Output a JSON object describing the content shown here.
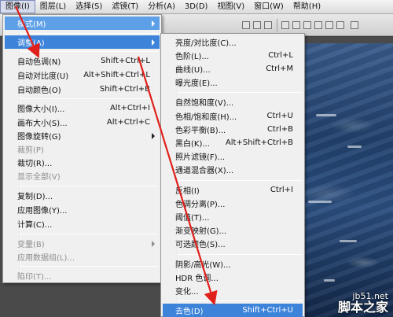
{
  "menubar": [
    "图像(I)",
    "图层(L)",
    "选择(S)",
    "滤镜(T)",
    "分析(A)",
    "3D(D)",
    "视图(V)",
    "窗口(W)",
    "帮助(H)"
  ],
  "image_menu": {
    "mode": "模式(M)",
    "adjust": "调整(A)",
    "auto_tone": {
      "label": "自动色调(N)",
      "shortcut": "Shift+Ctrl+L"
    },
    "auto_contrast": {
      "label": "自动对比度(U)",
      "shortcut": "Alt+Shift+Ctrl+L"
    },
    "auto_color": {
      "label": "自动颜色(O)",
      "shortcut": "Shift+Ctrl+B"
    },
    "image_size": {
      "label": "图像大小(I)...",
      "shortcut": "Alt+Ctrl+I"
    },
    "canvas_size": {
      "label": "画布大小(S)...",
      "shortcut": "Alt+Ctrl+C"
    },
    "rotate": "图像旋转(G)",
    "crop": "裁剪(P)",
    "trim": "裁切(R)...",
    "reveal_all": "显示全部(V)",
    "duplicate": "复制(D)...",
    "apply_image": "应用图像(Y)...",
    "calculations": "计算(C)...",
    "variables": "变量(B)",
    "apply_dataset": "应用数据组(L)...",
    "trap": "陷印(T)..."
  },
  "adjust_menu": {
    "brightness": "亮度/对比度(C)...",
    "levels": {
      "label": "色阶(L)...",
      "shortcut": "Ctrl+L"
    },
    "curves": {
      "label": "曲线(U)...",
      "shortcut": "Ctrl+M"
    },
    "exposure": "曝光度(E)...",
    "vibrance": "自然饱和度(V)...",
    "hue_sat": {
      "label": "色相/饱和度(H)...",
      "shortcut": "Ctrl+U"
    },
    "color_balance": {
      "label": "色彩平衡(B)...",
      "shortcut": "Ctrl+B"
    },
    "black_white": {
      "label": "黑白(K)...",
      "shortcut": "Alt+Shift+Ctrl+B"
    },
    "photo_filter": "照片滤镜(F)...",
    "channel_mixer": "通道混合器(X)...",
    "invert": {
      "label": "反相(I)",
      "shortcut": "Ctrl+I"
    },
    "posterize": "色调分离(P)...",
    "threshold": "阈值(T)...",
    "gradient_map": "渐变映射(G)...",
    "selective_color": "可选颜色(S)...",
    "shadows_highlights": "阴影/高光(W)...",
    "hdr_toning": "HDR 色调...",
    "variations": "变化...",
    "desaturate": {
      "label": "去色(D)",
      "shortcut": "Shift+Ctrl+U"
    }
  },
  "watermark": {
    "domain": "jb51.net",
    "site": "脚本之家"
  },
  "colors": {
    "highlight": "#3c83d9",
    "arrow": "#e0201a"
  }
}
